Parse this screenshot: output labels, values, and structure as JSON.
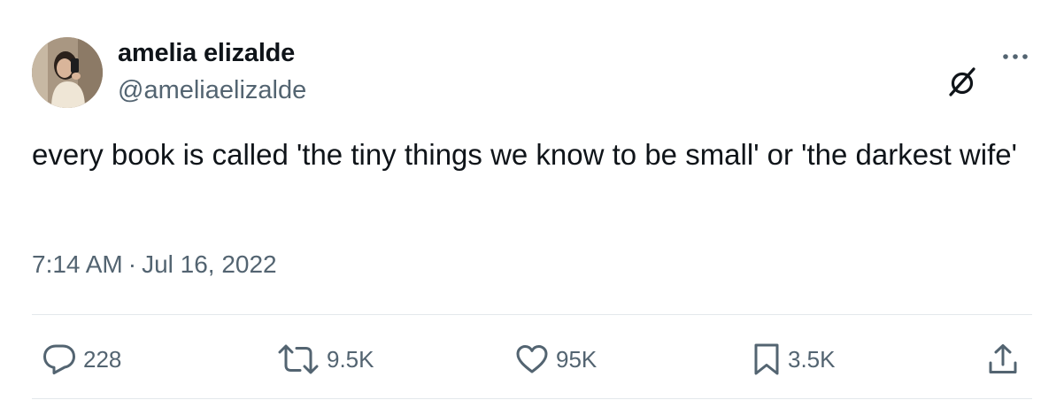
{
  "tweet": {
    "display_name": "amelia elizalde",
    "handle": "@ameliaelizalde",
    "text": "every book is called 'the tiny things we know to be small' or 'the darkest wife'",
    "time": "7:14 AM",
    "separator": "·",
    "date": "Jul 16, 2022"
  },
  "actions": {
    "replies": "228",
    "retweets": "9.5K",
    "likes": "95K",
    "bookmarks": "3.5K"
  },
  "icons": {
    "header": [
      "grok-icon",
      "more-options-icon"
    ],
    "actions": [
      "reply-icon",
      "retweet-icon",
      "like-icon",
      "bookmark-icon",
      "share-icon"
    ]
  },
  "colors": {
    "text_primary": "#0f1419",
    "text_secondary": "#536471",
    "divider": "#e3e8eb"
  }
}
